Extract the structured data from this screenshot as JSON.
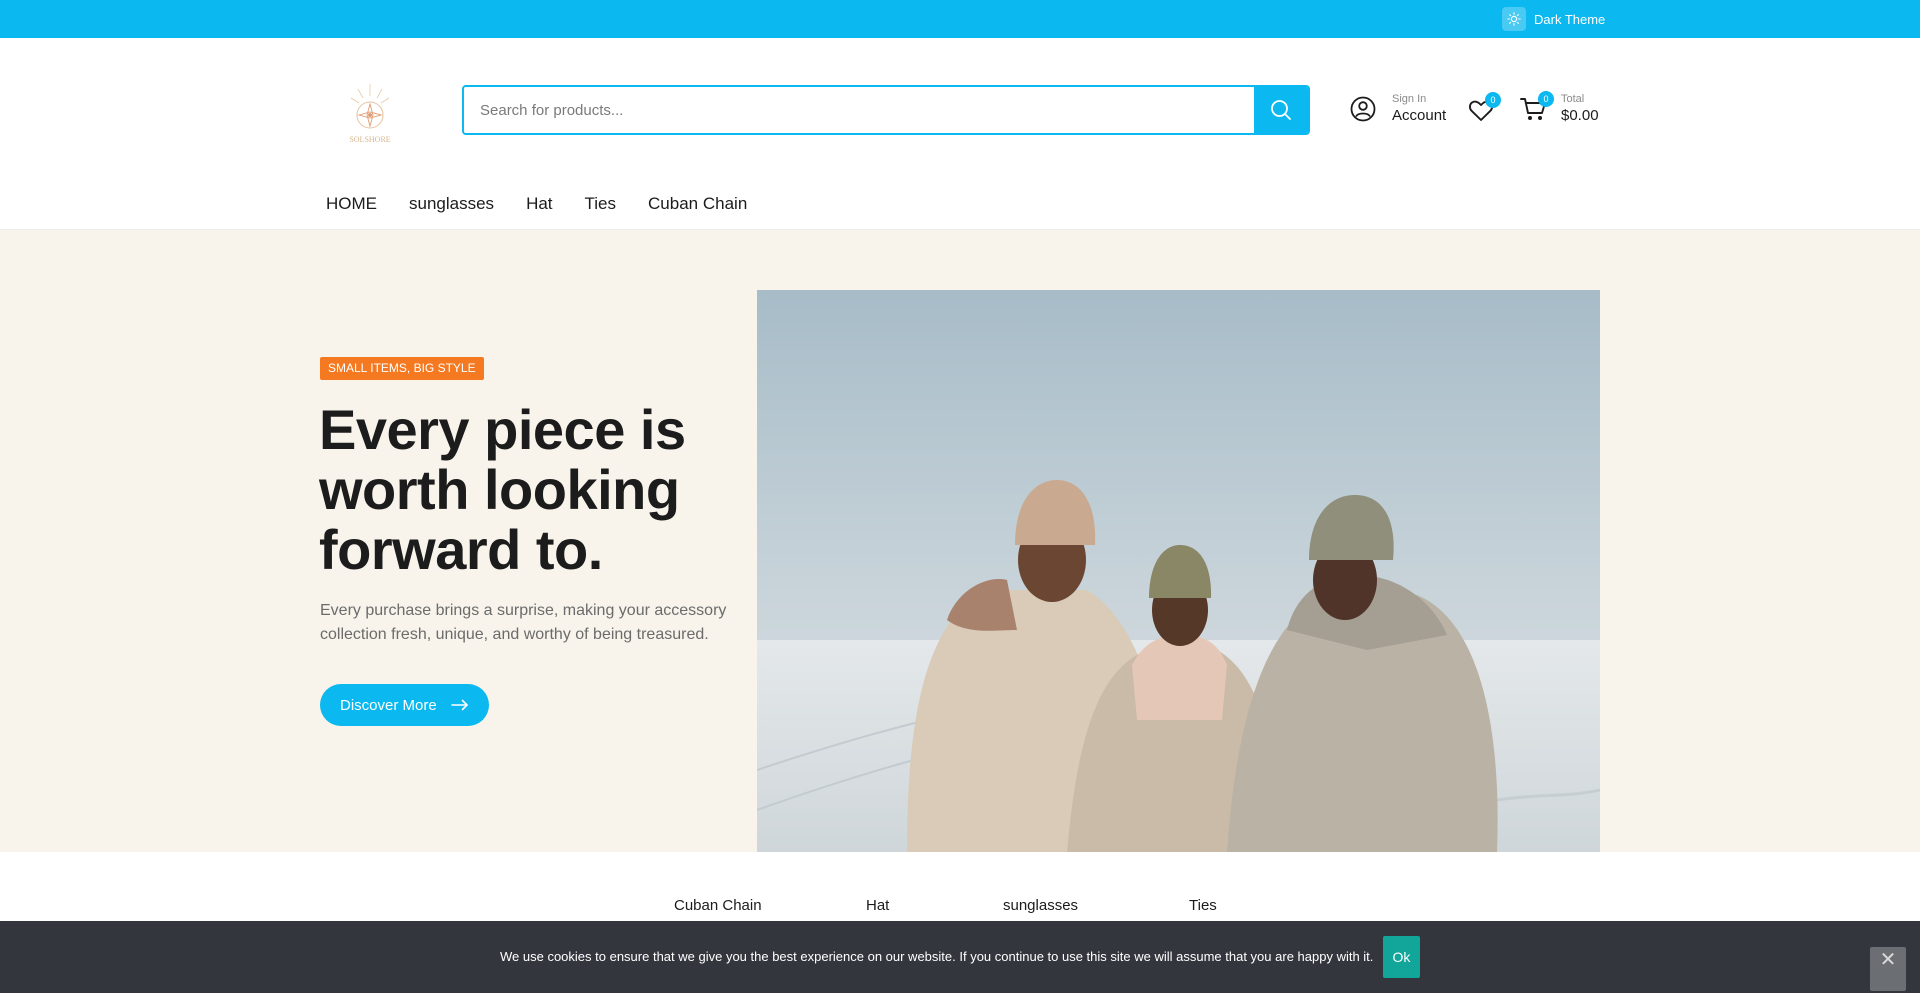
{
  "topbar": {
    "theme_toggle_label": "Dark Theme"
  },
  "header": {
    "search_placeholder": "Search for products...",
    "account": {
      "small": "Sign In",
      "big": "Account"
    },
    "wishlist_count": "0",
    "cart": {
      "count": "0",
      "small": "Total",
      "big": "$0.00"
    }
  },
  "nav": {
    "items": [
      "HOME",
      "sunglasses",
      "Hat",
      "Ties",
      "Cuban Chain"
    ]
  },
  "hero": {
    "tagline": "SMALL ITEMS, BIG STYLE",
    "headline": "Every piece is worth looking forward to.",
    "subtext": "Every purchase brings a surprise, making your accessory collection fresh, unique, and worthy of being treasured.",
    "cta_label": "Discover More"
  },
  "categories": [
    "Cuban Chain",
    "Hat",
    "sunglasses",
    "Ties"
  ],
  "cookie": {
    "text": "We use cookies to ensure that we give you the best experience on our website. If you continue to use this site we will assume that you are happy with it.",
    "ok_label": "Ok"
  },
  "colors": {
    "accent": "#0bb8ef",
    "tag": "#f47920",
    "hero_bg": "#f8f4ec",
    "cookie_bg": "#33363d",
    "ok": "#12a59a"
  },
  "icons": [
    "sun-icon",
    "search-icon",
    "user-icon",
    "heart-icon",
    "cart-icon",
    "arrow-right-icon",
    "close-icon"
  ]
}
